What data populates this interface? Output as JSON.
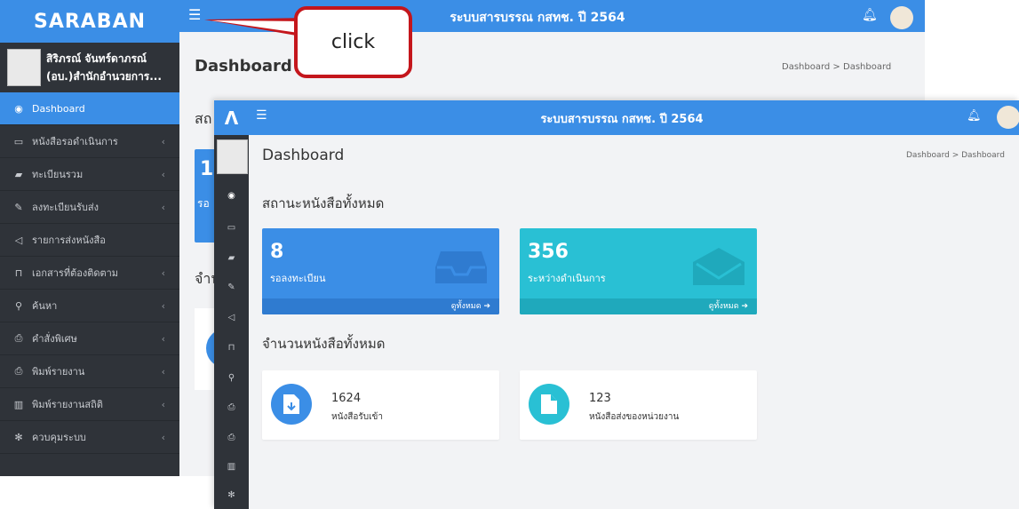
{
  "colors": {
    "primary": "#3b8ee6",
    "teal": "#29c0d4",
    "sidebar": "#2f3339",
    "callout_border": "#c4161c"
  },
  "back": {
    "logo": "SARABAN",
    "header_title": "ระบบสารบรรณ กสทช. ปี 2564",
    "user": {
      "name": "สิริภรณ์ จันทร์ดาภรณ์",
      "org": "(อบ.)สำนักอำนวยการ..."
    },
    "nav": [
      {
        "label": "Dashboard",
        "icon": "dashboard-icon",
        "active": true
      },
      {
        "label": "หนังสือรอดำเนินการ",
        "icon": "inbox-icon"
      },
      {
        "label": "ทะเบียนรวม",
        "icon": "book-icon"
      },
      {
        "label": "ลงทะเบียนรับส่ง",
        "icon": "edit-icon"
      },
      {
        "label": "รายการส่งหนังสือ",
        "icon": "send-icon"
      },
      {
        "label": "เอกสารที่ต้องติดตาม",
        "icon": "bookmark-icon"
      },
      {
        "label": "ค้นหา",
        "icon": "search-icon"
      },
      {
        "label": "คำสั่งพิเศษ",
        "icon": "print-icon"
      },
      {
        "label": "พิมพ์รายงาน",
        "icon": "print-icon"
      },
      {
        "label": "พิมพ์รายงานสถิติ",
        "icon": "chart-icon"
      },
      {
        "label": "ควบคุมระบบ",
        "icon": "gear-icon"
      }
    ],
    "page_title": "Dashboard",
    "breadcrumb": "Dashboard  >  Dashboard",
    "section1_partial": "สถ",
    "section2_partial": "จำน",
    "card1_num": "1",
    "card1_lbl": "รอ"
  },
  "callout": {
    "text": "click"
  },
  "front": {
    "logo": "Λ",
    "header_title": "ระบบสารบรรณ กสทช. ปี 2564",
    "page_title": "Dashboard",
    "breadcrumb": "Dashboard  >  Dashboard",
    "section1": "สถานะหนังสือทั้งหมด",
    "section2": "จำนวนหนังสือทั้งหมด",
    "stat_cards": [
      {
        "value": "8",
        "label": "รอลงทะเบียน",
        "link": "ดูทั้งหมด ➔",
        "color": "#3b8ee6",
        "foot_color": "#2f7bd0",
        "glyph": "inbox-icon"
      },
      {
        "value": "356",
        "label": "ระหว่างดำเนินการ",
        "link": "ดูทั้งหมด ➔",
        "color": "#29c0d4",
        "foot_color": "#1fa9bc",
        "glyph": "envelope-icon"
      }
    ],
    "info_cards": [
      {
        "value": "1624",
        "label": "หนังสือรับเข้า",
        "color": "#3b8ee6",
        "glyph": "file-download-icon"
      },
      {
        "value": "123",
        "label": "หนังสือส่งของหน่วยงาน",
        "color": "#29c0d4",
        "glyph": "file-icon"
      }
    ]
  }
}
